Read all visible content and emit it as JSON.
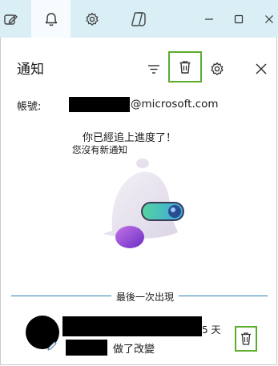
{
  "header": {
    "title": "通知"
  },
  "account": {
    "label": "帳號:",
    "email_domain": "@microsoft.com"
  },
  "empty_state": {
    "headline": "你已經追上進度了！",
    "subtext": "您沒有新通知"
  },
  "activity": {
    "section_label": "最後一次出現",
    "items": [
      {
        "time": "5 天",
        "action": "做了改變"
      }
    ]
  },
  "icons": {
    "tabs": [
      "edit-icon",
      "bell-icon",
      "gear-icon",
      "copilot-icon"
    ],
    "window": [
      "minimize-icon",
      "maximize-icon",
      "close-icon"
    ],
    "header": [
      "filter-icon",
      "trash-icon",
      "settings-icon",
      "close-icon"
    ]
  },
  "colors": {
    "topbar": "#d9eef5",
    "active_tab": "#f6fbfd",
    "highlight": "#5cac2d",
    "divider": "#2a7fb0"
  }
}
